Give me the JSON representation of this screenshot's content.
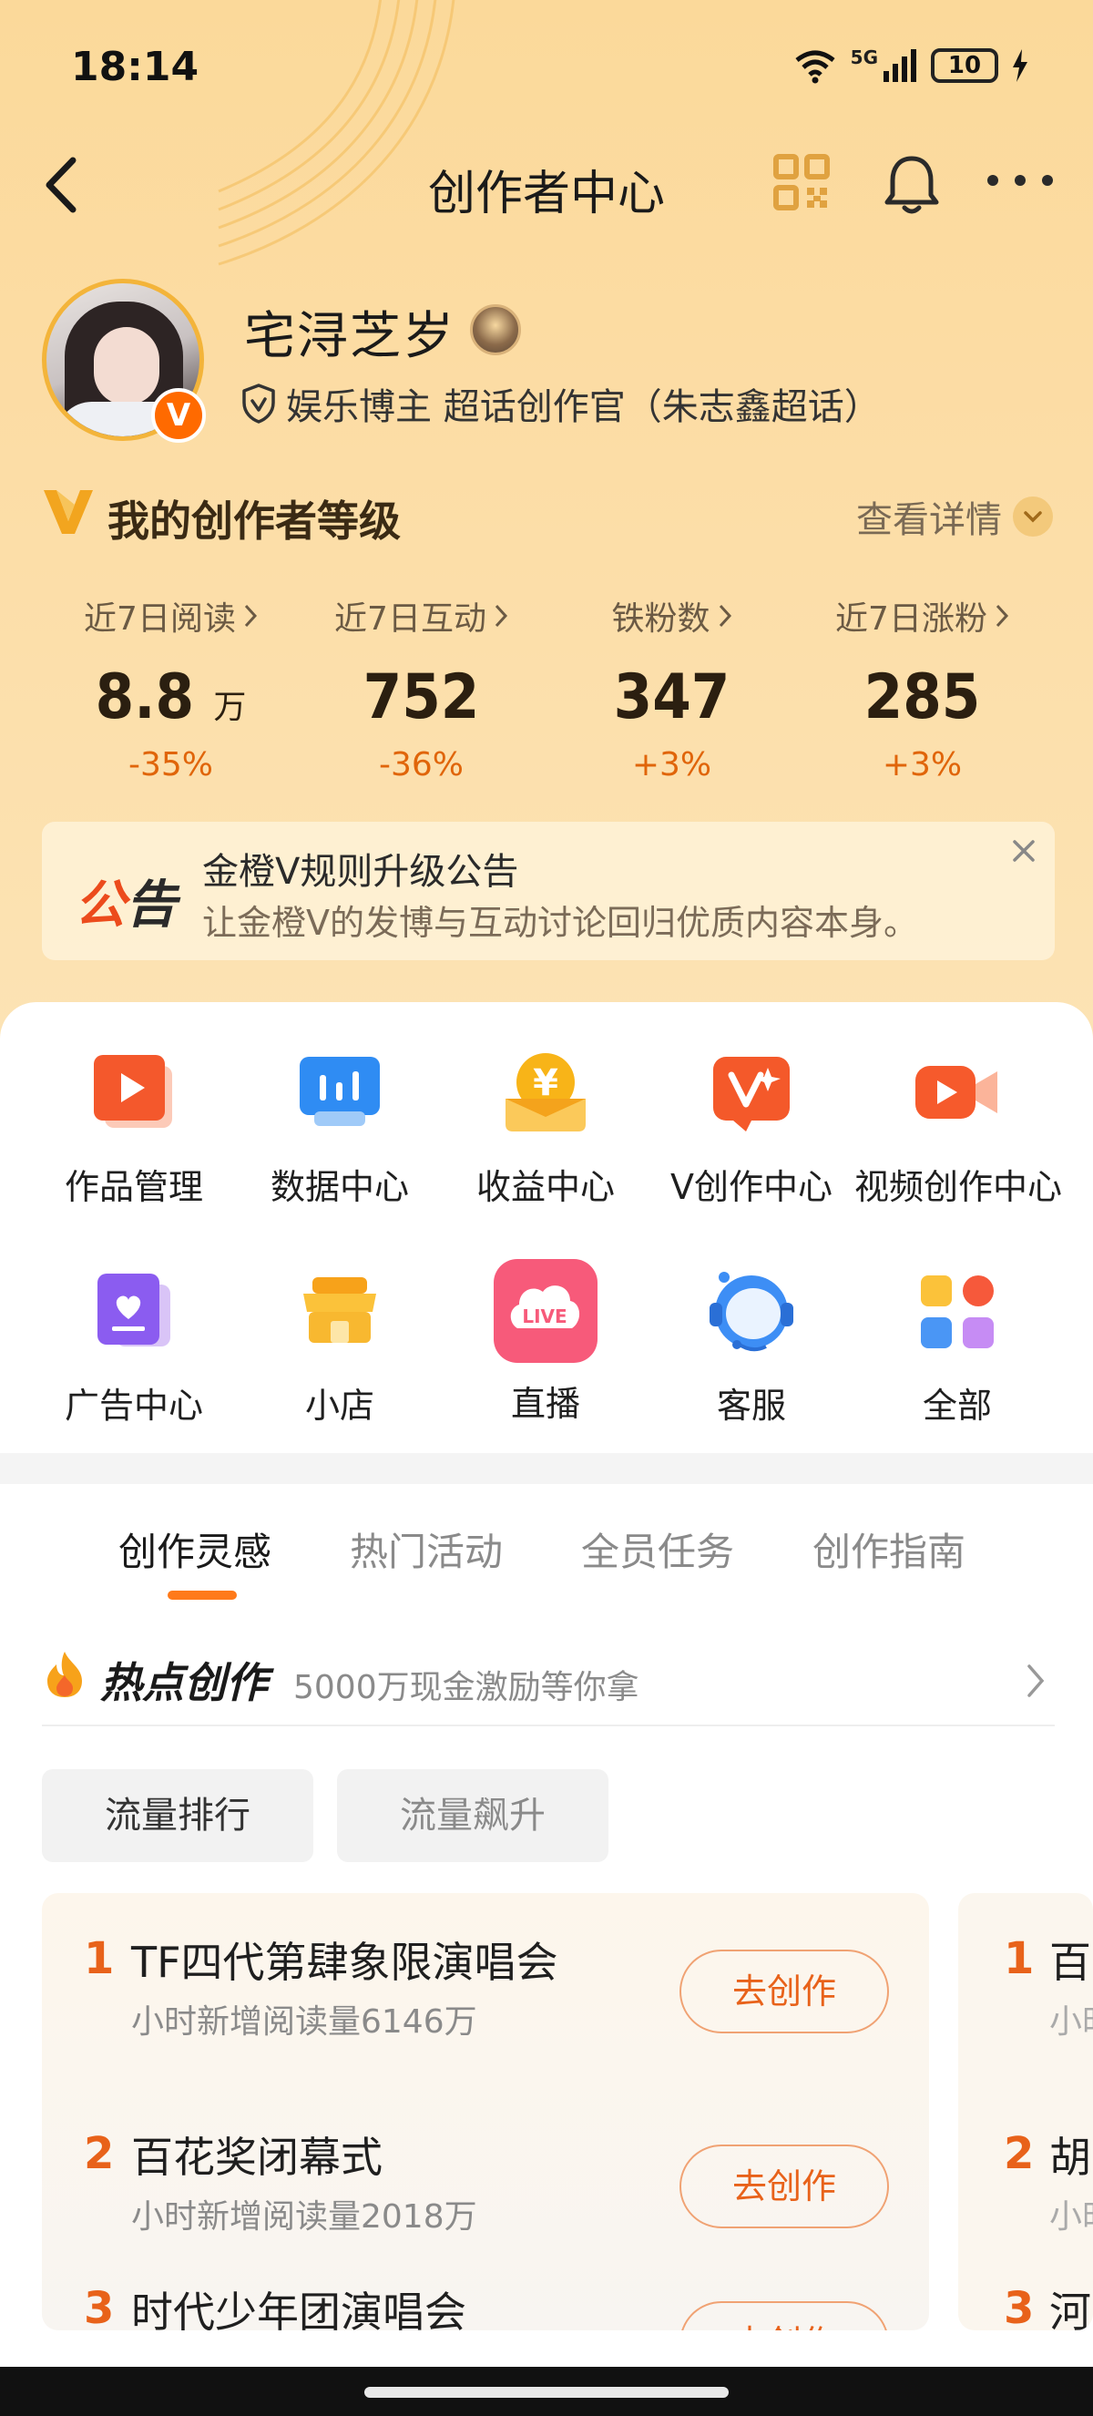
{
  "status_bar": {
    "time": "18:14",
    "network": "5G",
    "battery": "10"
  },
  "nav": {
    "title": "创作者中心"
  },
  "profile": {
    "username": "宅浔芝岁",
    "verify_text": "娱乐博主 超话创作官（朱志鑫超话）"
  },
  "creator_level": {
    "title": "我的创作者等级",
    "detail_label": "查看详情"
  },
  "stats": [
    {
      "label": "近7日阅读",
      "value": "8.8",
      "unit": "万",
      "change": "-35%"
    },
    {
      "label": "近7日互动",
      "value": "752",
      "unit": "",
      "change": "-36%"
    },
    {
      "label": "铁粉数",
      "value": "347",
      "unit": "",
      "change": "+3%"
    },
    {
      "label": "近7日涨粉",
      "value": "285",
      "unit": "",
      "change": "+3%"
    }
  ],
  "notice": {
    "tag_first": "公",
    "tag_second": "告",
    "title": "金橙V规则升级公告",
    "subtitle": "让金橙V的发博与互动讨论回归优质内容本身。"
  },
  "tools_row1": [
    {
      "label": "作品管理",
      "icon": "works-management-icon"
    },
    {
      "label": "数据中心",
      "icon": "data-center-icon"
    },
    {
      "label": "收益中心",
      "icon": "income-center-icon"
    },
    {
      "label": "V创作中心",
      "icon": "v-creation-center-icon"
    },
    {
      "label": "视频创作中心",
      "icon": "video-creation-center-icon"
    }
  ],
  "tools_row2": [
    {
      "label": "广告中心",
      "icon": "ad-center-icon"
    },
    {
      "label": "小店",
      "icon": "shop-icon"
    },
    {
      "label": "直播",
      "icon": "live-icon"
    },
    {
      "label": "客服",
      "icon": "customer-service-icon"
    },
    {
      "label": "全部",
      "icon": "all-icon"
    }
  ],
  "tabs": [
    "创作灵感",
    "热门活动",
    "全员任务",
    "创作指南"
  ],
  "hot": {
    "title": "热点创作",
    "subtitle": "5000万现金激励等你拿"
  },
  "filters": [
    "流量排行",
    "流量飙升"
  ],
  "rank_list": [
    {
      "rank": "1",
      "title": "TF四代第肆象限演唱会",
      "sub": "小时新增阅读量6146万",
      "button": "去创作"
    },
    {
      "rank": "2",
      "title": "百花奖闭幕式",
      "sub": "小时新增阅读量2018万",
      "button": "去创作"
    },
    {
      "rank": "3",
      "title": "时代少年团演唱会",
      "sub": "",
      "button": "去创作"
    }
  ],
  "rank_list_2": [
    {
      "rank": "1",
      "title": "百",
      "sub": "小时"
    },
    {
      "rank": "2",
      "title": "胡",
      "sub": "小时"
    },
    {
      "rank": "3",
      "title": "河",
      "sub": ""
    }
  ],
  "colors": {
    "accent": "#ff7a1a",
    "rank_orange": "#e8621a",
    "hero_bg": "#fcdda6"
  }
}
